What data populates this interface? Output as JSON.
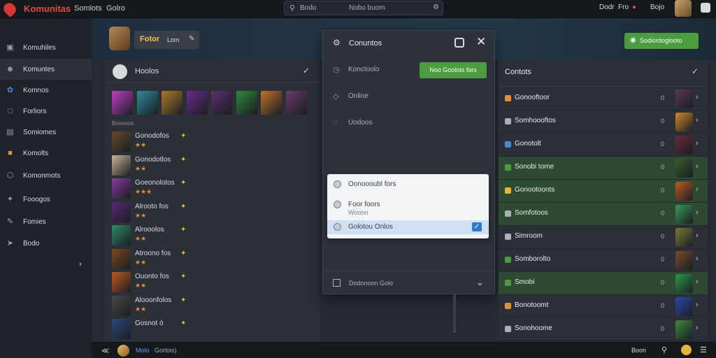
{
  "topbar": {
    "brand": "Komunitas",
    "nav": [
      "Somlots",
      "Golro"
    ],
    "search": {
      "prefix": "Bodo",
      "placeholder": "Nobo buom"
    },
    "right": [
      "Dodr",
      "Fro",
      "Bojo"
    ]
  },
  "sidebar": {
    "items": [
      {
        "label": "Komuhiles",
        "icon": "square-icon"
      },
      {
        "label": "Komuntes",
        "icon": "user-icon"
      },
      {
        "label": "Komnos",
        "icon": "globe-icon"
      },
      {
        "label": "Forliors",
        "icon": "chat-icon"
      },
      {
        "label": "Somiomes",
        "icon": "list-icon"
      },
      {
        "label": "Komolts",
        "icon": "tag-icon"
      },
      {
        "label": "Komonmots",
        "icon": "cube-icon"
      },
      {
        "label": "Fooogos",
        "icon": "puzzle-icon"
      },
      {
        "label": "Fomies",
        "icon": "pencil-icon"
      },
      {
        "label": "Bodo",
        "icon": "share-icon"
      }
    ]
  },
  "banner": {
    "badge_title": "Fotor",
    "badge_sub": "Lom",
    "button": "Sodiordoglooto"
  },
  "friends_panel": {
    "title": "Hoolos",
    "subhead": "Bovooos",
    "heroes": [
      "#c13fc4",
      "#2f8c9a",
      "#b07a2a",
      "#6a2c8a",
      "#5a3070",
      "#2e8a3a",
      "#c0702a",
      "#6a3a6a"
    ],
    "rows": [
      {
        "name": "Gonodofos",
        "status": "★★",
        "color": "#6b4a2b"
      },
      {
        "name": "Gonodotlos",
        "status": "★★",
        "color": "#c9b59a"
      },
      {
        "name": "Goeonolotos",
        "status": "★★★",
        "color": "#8a3aa0"
      },
      {
        "name": "Alrooto fos",
        "status": "★★",
        "color": "#5a2a7a"
      },
      {
        "name": "Alrooolos",
        "status": "★★",
        "color": "#2f8c6a"
      },
      {
        "name": "Atroono fos",
        "status": "★★",
        "color": "#7a4a20"
      },
      {
        "name": "Ouonto fos",
        "status": "★★",
        "color": "#c05a20"
      },
      {
        "name": "Alooonfolos",
        "status": "★★",
        "color": "#4a4a4a"
      },
      {
        "name": "Gosnot ó",
        "status": "",
        "color": "#2a4a7a"
      }
    ]
  },
  "modal": {
    "title": "Conuntos",
    "rows": [
      "Konctoolo",
      "Online",
      "Uodoos"
    ],
    "green_button": "Noo Goolots fors",
    "footer": "Dodonoon Golo"
  },
  "dropdown": {
    "options": [
      "Oonoooubl fors",
      "Foor foors",
      "Wooon",
      "Golotou Onlos"
    ]
  },
  "contacts_panel": {
    "title": "Contots",
    "rows": [
      {
        "label": "Gonooftoor",
        "num": "0",
        "icon": "#e08f3c",
        "avatar": "#5a3a5a",
        "green": false
      },
      {
        "label": "Somhoooftos",
        "num": "0",
        "icon": "#aab0b7",
        "avatar": "#d08a2a",
        "green": false
      },
      {
        "label": "Gonotolt",
        "num": "0",
        "icon": "#4a8ad0",
        "avatar": "#6a2a3a",
        "green": false
      },
      {
        "label": "Sonobi tome",
        "num": "0",
        "icon": "#4a9c3e",
        "avatar": "#3a5a2a",
        "green": true
      },
      {
        "label": "Gonootoonts",
        "num": "0",
        "icon": "#e3b53a",
        "avatar": "#c05a20",
        "green": true
      },
      {
        "label": "Somfotoos",
        "num": "0",
        "icon": "#aab0b7",
        "avatar": "#3a9a5a",
        "green": true
      },
      {
        "label": "Simroom",
        "num": "0",
        "icon": "#aab0b7",
        "avatar": "#7a7a3a",
        "green": false
      },
      {
        "label": "Somborolto",
        "num": "0",
        "icon": "#4a9c3e",
        "avatar": "#7a4a2a",
        "green": false
      },
      {
        "label": "Smobi",
        "num": "0",
        "icon": "#4a9c3e",
        "avatar": "#2a9a4a",
        "green": true
      },
      {
        "label": "Bonotoomt",
        "num": "0",
        "icon": "#e08f3c",
        "avatar": "#2a4aaa",
        "green": false
      },
      {
        "label": "Sonohoome",
        "num": "0",
        "icon": "#aab0b7",
        "avatar": "#3a8a3a",
        "green": false
      }
    ]
  },
  "bottombar": {
    "name": "Molo",
    "status": "Gorlois)",
    "right": "Boon"
  }
}
